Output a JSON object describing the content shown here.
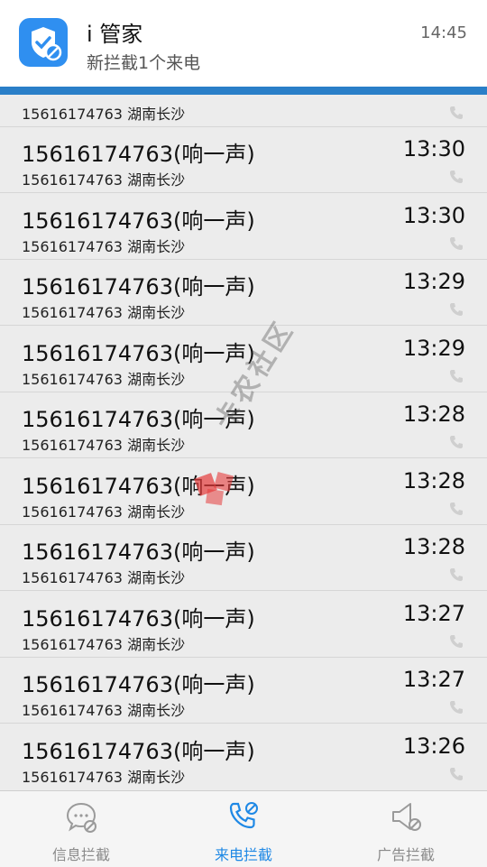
{
  "notification": {
    "app_name": "i 管家",
    "message": "新拦截1个来电",
    "time": "14:45",
    "icon": "shield-check-icon",
    "accent": "#2f8ff0"
  },
  "calls": {
    "partial_row": {
      "sub": "15616174763 湖南长沙"
    },
    "rows": [
      {
        "number": "15616174763(响一声)",
        "time": "13:30",
        "sub": "15616174763 湖南长沙"
      },
      {
        "number": "15616174763(响一声)",
        "time": "13:30",
        "sub": "15616174763 湖南长沙"
      },
      {
        "number": "15616174763(响一声)",
        "time": "13:29",
        "sub": "15616174763 湖南长沙"
      },
      {
        "number": "15616174763(响一声)",
        "time": "13:29",
        "sub": "15616174763 湖南长沙"
      },
      {
        "number": "15616174763(响一声)",
        "time": "13:28",
        "sub": "15616174763 湖南长沙"
      },
      {
        "number": "15616174763(响一声)",
        "time": "13:28",
        "sub": "15616174763 湖南长沙"
      },
      {
        "number": "15616174763(响一声)",
        "time": "13:28",
        "sub": "15616174763 湖南长沙"
      },
      {
        "number": "15616174763(响一声)",
        "time": "13:27",
        "sub": "15616174763 湖南长沙"
      },
      {
        "number": "15616174763(响一声)",
        "time": "13:27",
        "sub": "15616174763 湖南长沙"
      },
      {
        "number": "15616174763(响一声)",
        "time": "13:26",
        "sub": "15616174763 湖南长沙"
      }
    ]
  },
  "watermark": {
    "text": "卡农社区"
  },
  "tabs": [
    {
      "label": "信息拦截",
      "icon": "message-block-icon",
      "active": false
    },
    {
      "label": "来电拦截",
      "icon": "phone-block-icon",
      "active": true
    },
    {
      "label": "广告拦截",
      "icon": "speaker-block-icon",
      "active": false
    }
  ],
  "colors": {
    "active_tab": "#1e88e5",
    "inactive_tab": "#8a8a8a",
    "banner_bar": "#2a7fc8"
  }
}
